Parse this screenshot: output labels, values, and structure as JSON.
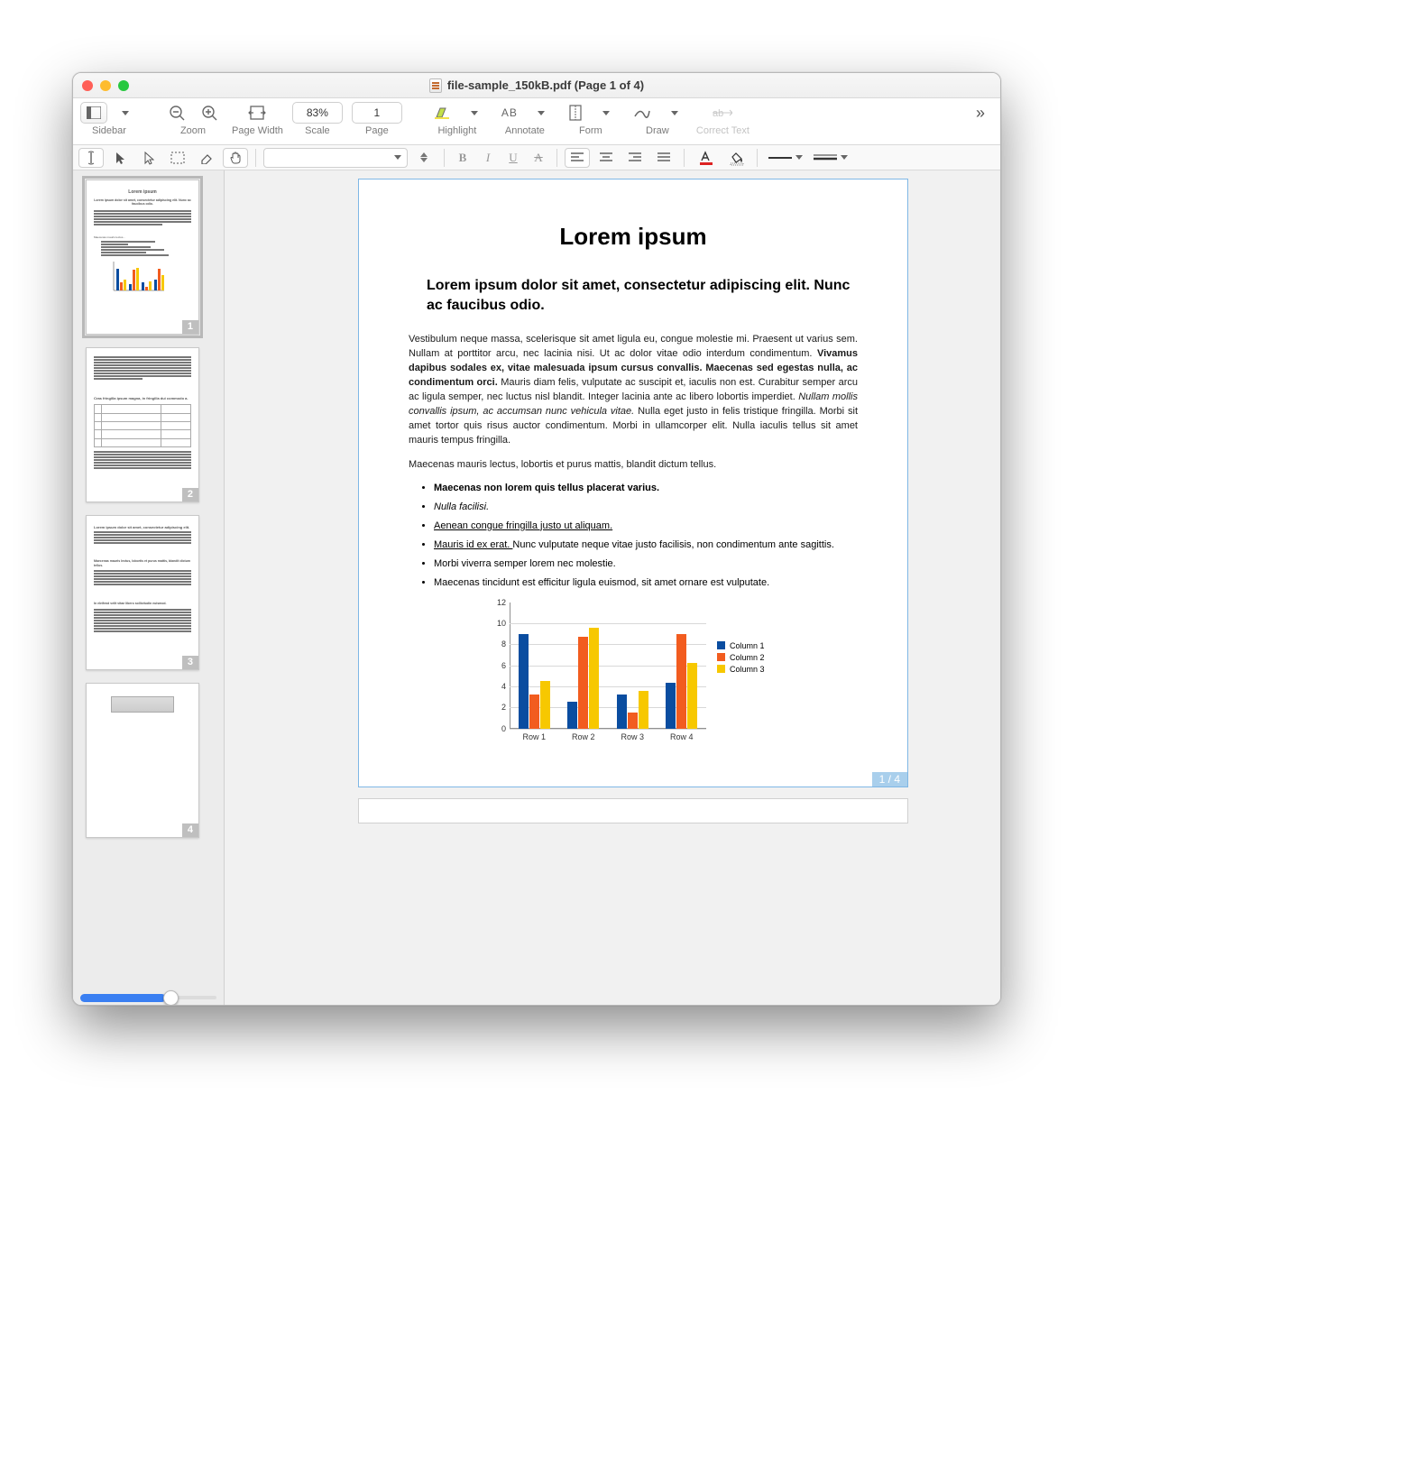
{
  "window": {
    "title": "file-sample_150kB.pdf (Page 1 of 4)"
  },
  "toolbar": {
    "sidebar": "Sidebar",
    "zoom": "Zoom",
    "pagewidth": "Page Width",
    "scale": "Scale",
    "scale_value": "83%",
    "page": "Page",
    "page_value": "1",
    "highlight": "Highlight",
    "annotate": "Annotate",
    "form": "Form",
    "draw": "Draw",
    "correct": "Correct Text"
  },
  "sidebar": {
    "pages": [
      "1",
      "2",
      "3",
      "4"
    ],
    "selected": 1
  },
  "page_indicator": "1 / 4",
  "doc": {
    "title": "Lorem ipsum",
    "subtitle": "Lorem ipsum dolor sit amet, consectetur adipiscing elit. Nunc ac faucibus odio.",
    "para1a": "Vestibulum neque massa, scelerisque sit amet ligula eu, congue molestie mi. Praesent ut varius sem. Nullam at porttitor arcu, nec lacinia nisi. Ut ac dolor vitae odio interdum condimentum. ",
    "para1b": "Vivamus dapibus sodales ex, vitae malesuada ipsum cursus convallis. Maecenas sed egestas nulla, ac condimentum orci.",
    "para1c": " Mauris diam felis, vulputate ac suscipit et, iaculis non est. Curabitur semper arcu ac ligula semper, nec luctus nisl blandit. Integer lacinia ante ac libero lobortis imperdiet. ",
    "para1d": "Nullam mollis convallis ipsum, ac accumsan nunc vehicula vitae.",
    "para1e": " Nulla eget justo in felis tristique fringilla. Morbi sit amet tortor quis risus auctor condimentum. Morbi in ullamcorper elit. Nulla iaculis tellus sit amet mauris tempus fringilla.",
    "para2": "Maecenas mauris lectus, lobortis et purus mattis, blandit dictum tellus.",
    "b1": "Maecenas non lorem quis tellus placerat varius.",
    "b2": "Nulla facilisi.",
    "b3": "Aenean congue fringilla justo ut aliquam. ",
    "b4a": "Mauris id ex erat. ",
    "b4b": "Nunc vulputate neque vitae justo facilisis, non condimentum ante sagittis.",
    "b5": "Morbi viverra semper lorem nec molestie.",
    "b6": "Maecenas tincidunt est efficitur ligula euismod, sit amet ornare est vulputate."
  },
  "chart_data": {
    "type": "bar",
    "categories": [
      "Row 1",
      "Row 2",
      "Row 3",
      "Row 4"
    ],
    "series": [
      {
        "name": "Column 1",
        "color": "#0a4da0",
        "values": [
          9.0,
          2.5,
          3.2,
          4.3
        ]
      },
      {
        "name": "Column 2",
        "color": "#f25c1f",
        "values": [
          3.2,
          8.7,
          1.5,
          9.0
        ]
      },
      {
        "name": "Column 3",
        "color": "#f7c800",
        "values": [
          4.5,
          9.6,
          3.6,
          6.2
        ]
      }
    ],
    "ylim": [
      0,
      12
    ],
    "yticks": [
      0,
      2,
      4,
      6,
      8,
      10,
      12
    ],
    "legend": [
      "Column 1",
      "Column 2",
      "Column 3"
    ]
  }
}
